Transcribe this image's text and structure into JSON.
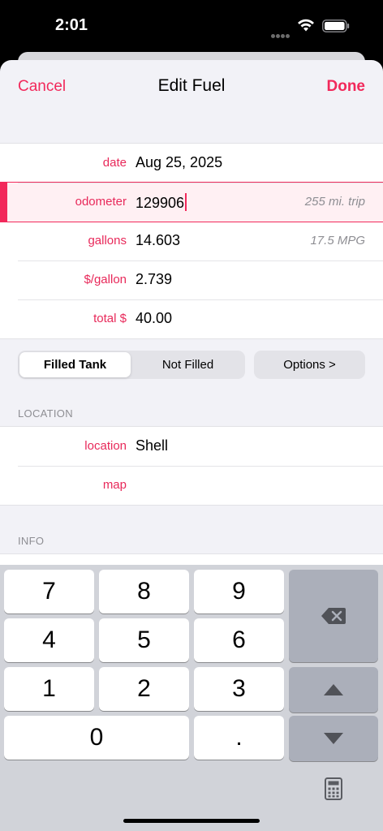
{
  "status": {
    "time": "2:01"
  },
  "nav": {
    "cancel": "Cancel",
    "title": "Edit Fuel",
    "done": "Done"
  },
  "fields": [
    {
      "label": "date",
      "value": "Aug 25, 2025",
      "hint": ""
    },
    {
      "label": "odometer",
      "value": "129906",
      "hint": "255 mi. trip"
    },
    {
      "label": "gallons",
      "value": "14.603",
      "hint": "17.5 MPG"
    },
    {
      "label": "$/gallon",
      "value": "2.739",
      "hint": ""
    },
    {
      "label": "total $",
      "value": "40.00",
      "hint": ""
    }
  ],
  "tank": {
    "filled": "Filled Tank",
    "not_filled": "Not Filled",
    "options": "Options >"
  },
  "location_section": {
    "header": "LOCATION",
    "rows": [
      {
        "label": "location",
        "value": "Shell"
      },
      {
        "label": "map",
        "value": ""
      }
    ]
  },
  "info_section": {
    "header": "INFO"
  },
  "keyboard": {
    "keys": [
      "7",
      "8",
      "9",
      "4",
      "5",
      "6",
      "1",
      "2",
      "3",
      "0",
      "."
    ]
  },
  "colors": {
    "accent": "#f2295b",
    "label": "#e8295a"
  }
}
